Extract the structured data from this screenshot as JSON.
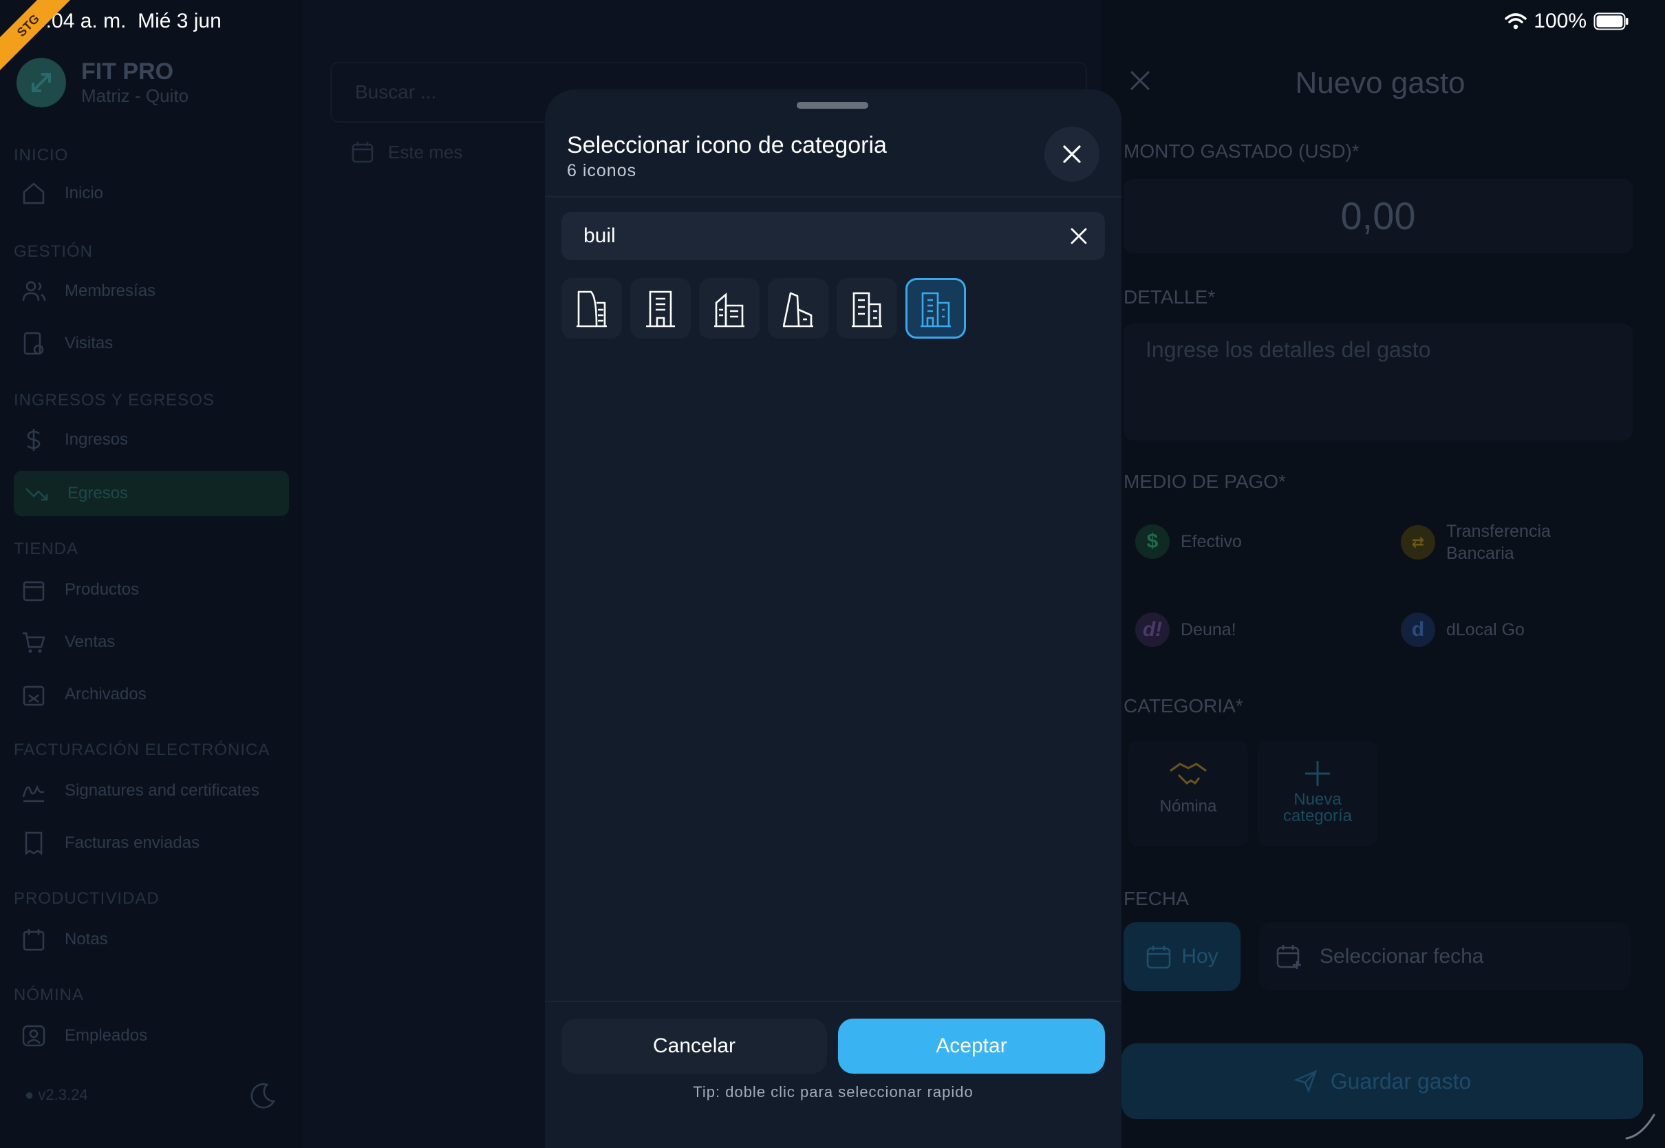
{
  "status_bar": {
    "time": "8:04 a. m.  Mié 3 jun",
    "battery": "100%",
    "badge": "STG"
  },
  "sidebar": {
    "brand_name": "FIT PRO",
    "brand_sub": "Matriz - Quito",
    "sections": {
      "inicio": "INICIO",
      "gestion": "GESTIÓN",
      "ingresos_egresos": "INGRESOS Y EGRESOS",
      "tienda": "TIENDA",
      "facturacion": "FACTURACIÓN ELECTRÓNICA",
      "productividad": "PRODUCTIVIDAD",
      "nomina": "NÓMINA"
    },
    "items": {
      "inicio": "Inicio",
      "membresias": "Membresías",
      "visitas": "Visitas",
      "ingresos": "Ingresos",
      "egresos": "Egresos",
      "productos": "Productos",
      "ventas": "Ventas",
      "archivados": "Archivados",
      "signatures": "Signatures and certificates",
      "facturas": "Facturas enviadas",
      "notas": "Notas",
      "empleados": "Empleados"
    },
    "version": "v2.3.24"
  },
  "list": {
    "search_placeholder": "Buscar ...",
    "period": "Este mes"
  },
  "expense_form": {
    "title": "Nuevo gasto",
    "amount_label": "MONTO GASTADO (USD)*",
    "amount_value": "0,00",
    "detail_label": "DETALLE*",
    "detail_placeholder": "Ingrese los detalles del gasto",
    "payment_label": "MEDIO DE PAGO*",
    "payments": {
      "efectivo": "Efectivo",
      "transferencia_line1": "Transferencia",
      "transferencia_line2": "Bancaria",
      "deuna": "Deuna!",
      "dlocal": "dLocal Go"
    },
    "category_label": "CATEGORIA*",
    "category_nomina": "Nómina",
    "category_new_line1": "Nueva",
    "category_new_line2": "categoría",
    "date_label": "FECHA",
    "date_today": "Hoy",
    "date_select": "Seleccionar fecha",
    "save_button": "Guardar gasto"
  },
  "modal": {
    "title": "Seleccionar icono de categoria",
    "subtitle": "6 iconos",
    "search_value": "buil",
    "icons": [
      "building-icon",
      "building-2-icon",
      "building-community-icon",
      "building-skyscraper-icon",
      "building-estate-icon",
      "buildings-icon"
    ],
    "selected_index": 5,
    "cancel_label": "Cancelar",
    "accept_label": "Aceptar",
    "tip": "Tip: doble clic para seleccionar rapido"
  },
  "colors": {
    "accent": "#3ab3f2",
    "modal_bg": "#131c2b",
    "page_bg": "#0c1220"
  }
}
